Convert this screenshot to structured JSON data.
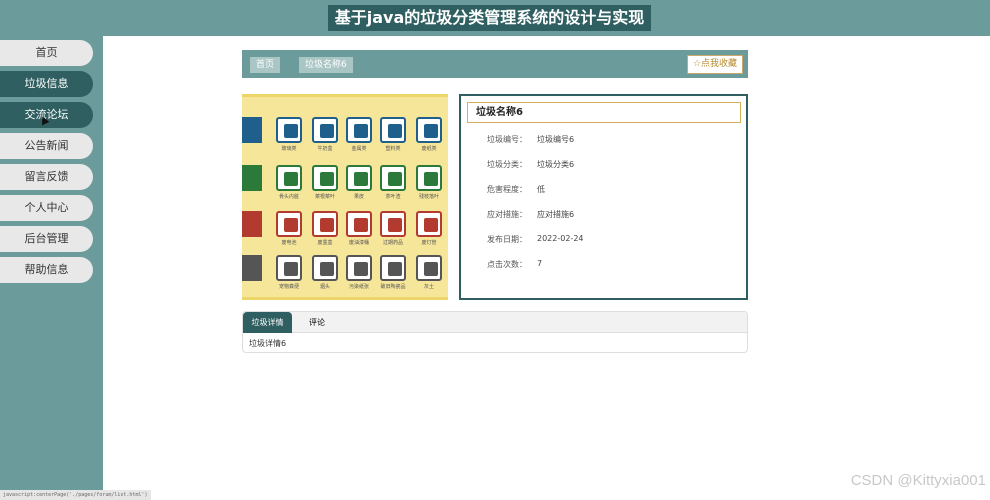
{
  "header": {
    "title": "基于java的垃圾分类管理系统的设计与实现"
  },
  "sidebar": {
    "items": [
      {
        "label": "首页",
        "active": false
      },
      {
        "label": "垃圾信息",
        "active": true
      },
      {
        "label": "交流论坛",
        "active": true
      },
      {
        "label": "公告新闻",
        "active": false
      },
      {
        "label": "留言反馈",
        "active": false
      },
      {
        "label": "个人中心",
        "active": false
      },
      {
        "label": "后台管理",
        "active": false
      },
      {
        "label": "帮助信息",
        "active": false
      }
    ]
  },
  "breadcrumb": {
    "home": "首页",
    "current": "垃圾名称6"
  },
  "favorite_button": "☆点我收藏",
  "image": {
    "rows": [
      {
        "color": "#1f5f8b",
        "signs": [
          "玻璃类",
          "牛奶盒",
          "金属类",
          "塑料类",
          "废纸类"
        ]
      },
      {
        "color": "#2b7a3a",
        "signs": [
          "骨头内脏",
          "菜根菜叶",
          "果皮",
          "茶叶渣",
          "残枝落叶"
        ]
      },
      {
        "color": "#b23a2e",
        "signs": [
          "废电池",
          "废墨盒",
          "废油漆桶",
          "过期药品",
          "废灯管"
        ]
      },
      {
        "color": "#555555",
        "signs": [
          "宠物粪便",
          "烟头",
          "污染纸张",
          "破旧陶瓷品",
          "灰土"
        ]
      }
    ]
  },
  "detail": {
    "name": "垃圾名称6",
    "fields": [
      {
        "label": "垃圾编号：",
        "value": "垃圾编号6"
      },
      {
        "label": "垃圾分类：",
        "value": "垃圾分类6"
      },
      {
        "label": "危害程度：",
        "value": "低"
      },
      {
        "label": "应对措施：",
        "value": "应对措施6"
      },
      {
        "label": "发布日期：",
        "value": "2022-02-24"
      },
      {
        "label": "点击次数：",
        "value": "7"
      }
    ]
  },
  "tabs": {
    "items": [
      {
        "label": "垃圾详情",
        "active": true
      },
      {
        "label": "评论",
        "active": false
      }
    ],
    "content": "垃圾详情6"
  },
  "status_url": "javascript:centerPage('./pages/forum/list.html')",
  "watermark": "CSDN @Kittyxia001",
  "colors": {
    "primary": "#2f5f61",
    "sidebar_bg": "#6b9c9b",
    "accent": "#b78a2e"
  }
}
